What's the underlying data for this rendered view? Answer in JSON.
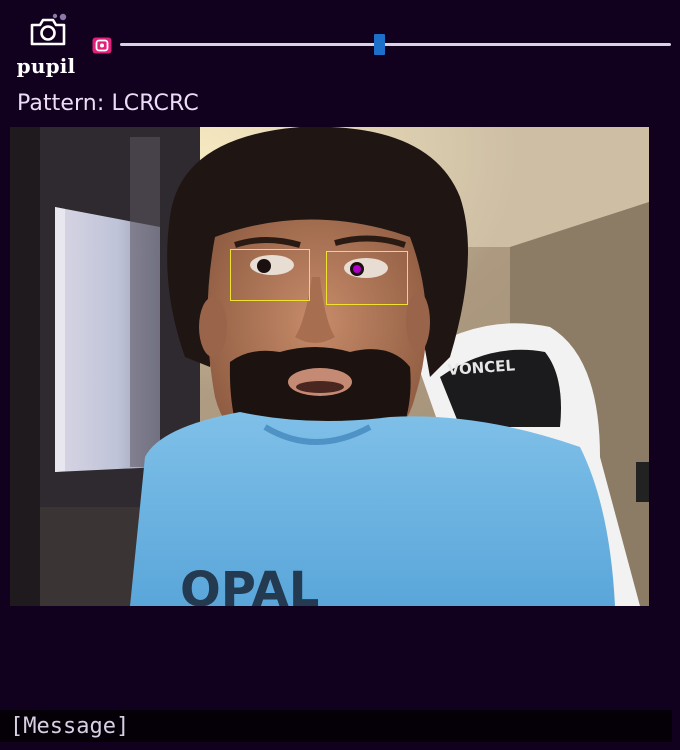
{
  "header": {
    "logo_icon": "camera-icon",
    "logo_text": "pupil",
    "record_icon": "record-icon"
  },
  "playback": {
    "position_fraction": 0.47
  },
  "pattern": {
    "label": "Pattern: LCRCRC"
  },
  "video": {
    "overlays": [
      "left-eye-box",
      "right-eye-box"
    ],
    "pupil_marker_color": "#b000c8",
    "eye_box_color": "#f0e030",
    "shirt_text": "OPAL"
  },
  "message": {
    "text": "[Message]"
  },
  "colors": {
    "background": "#12001f",
    "accent": "#e0217a",
    "slider_thumb": "#1d70c9",
    "slider_track": "#d7d2e4"
  }
}
